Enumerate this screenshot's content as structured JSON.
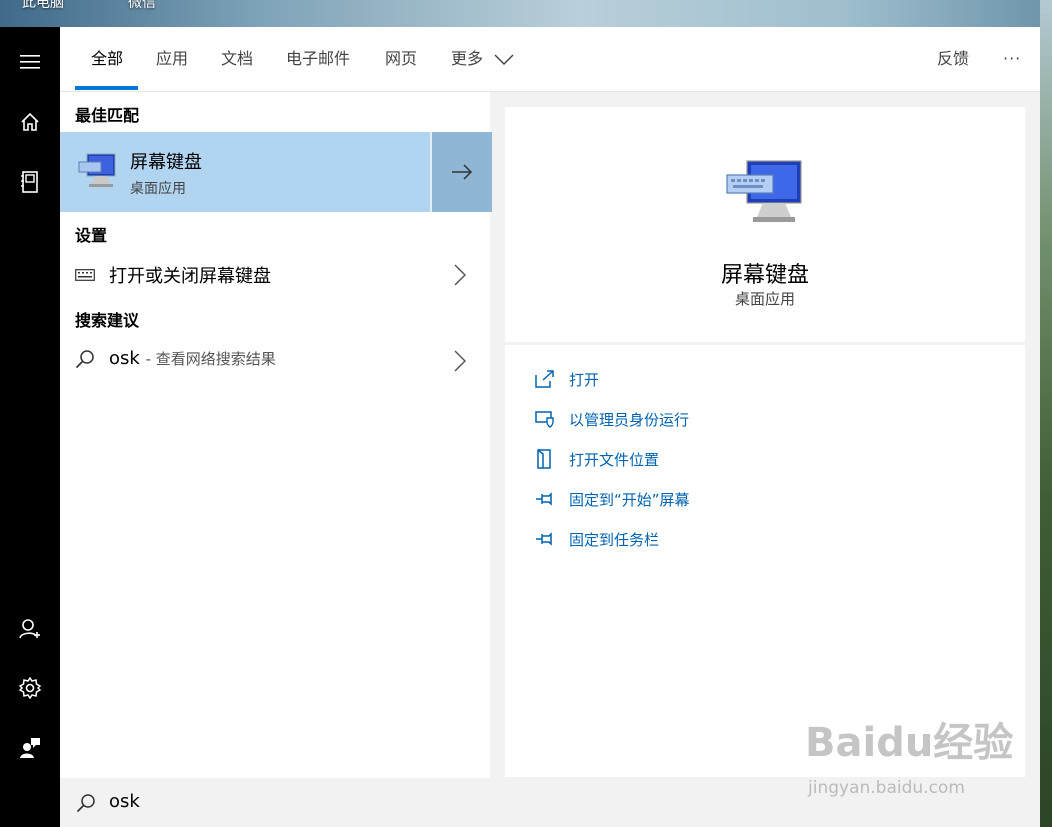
{
  "desktop": {
    "icon_labels": [
      "此电脑",
      "微信"
    ]
  },
  "rail": {
    "icons": [
      "hamburger-icon",
      "home-icon",
      "documents-icon",
      "user-add-icon",
      "gear-icon",
      "feedback-person-icon"
    ]
  },
  "tabs": {
    "items": [
      "全部",
      "应用",
      "文档",
      "电子邮件",
      "网页",
      "更多"
    ],
    "feedback_label": "反馈",
    "more_options": "···"
  },
  "results": {
    "best_match_heading": "最佳匹配",
    "best_match": {
      "title": "屏幕键盘",
      "subtitle": "桌面应用"
    },
    "settings_heading": "设置",
    "settings_item": "打开或关闭屏幕键盘",
    "suggest_heading": "搜索建议",
    "suggest_query": "osk",
    "suggest_desc": "- 查看网络搜索结果"
  },
  "detail": {
    "title": "屏幕键盘",
    "subtitle": "桌面应用",
    "actions": [
      "打开",
      "以管理员身份运行",
      "打开文件位置",
      "固定到“开始”屏幕",
      "固定到任务栏"
    ]
  },
  "search": {
    "value": "osk"
  },
  "watermark": {
    "main": "Baidu经验",
    "sub": "jingyan.baidu.com"
  },
  "colors": {
    "accent": "#0078d7",
    "selected_bg": "#b1d5f0",
    "link": "#0063b1"
  }
}
